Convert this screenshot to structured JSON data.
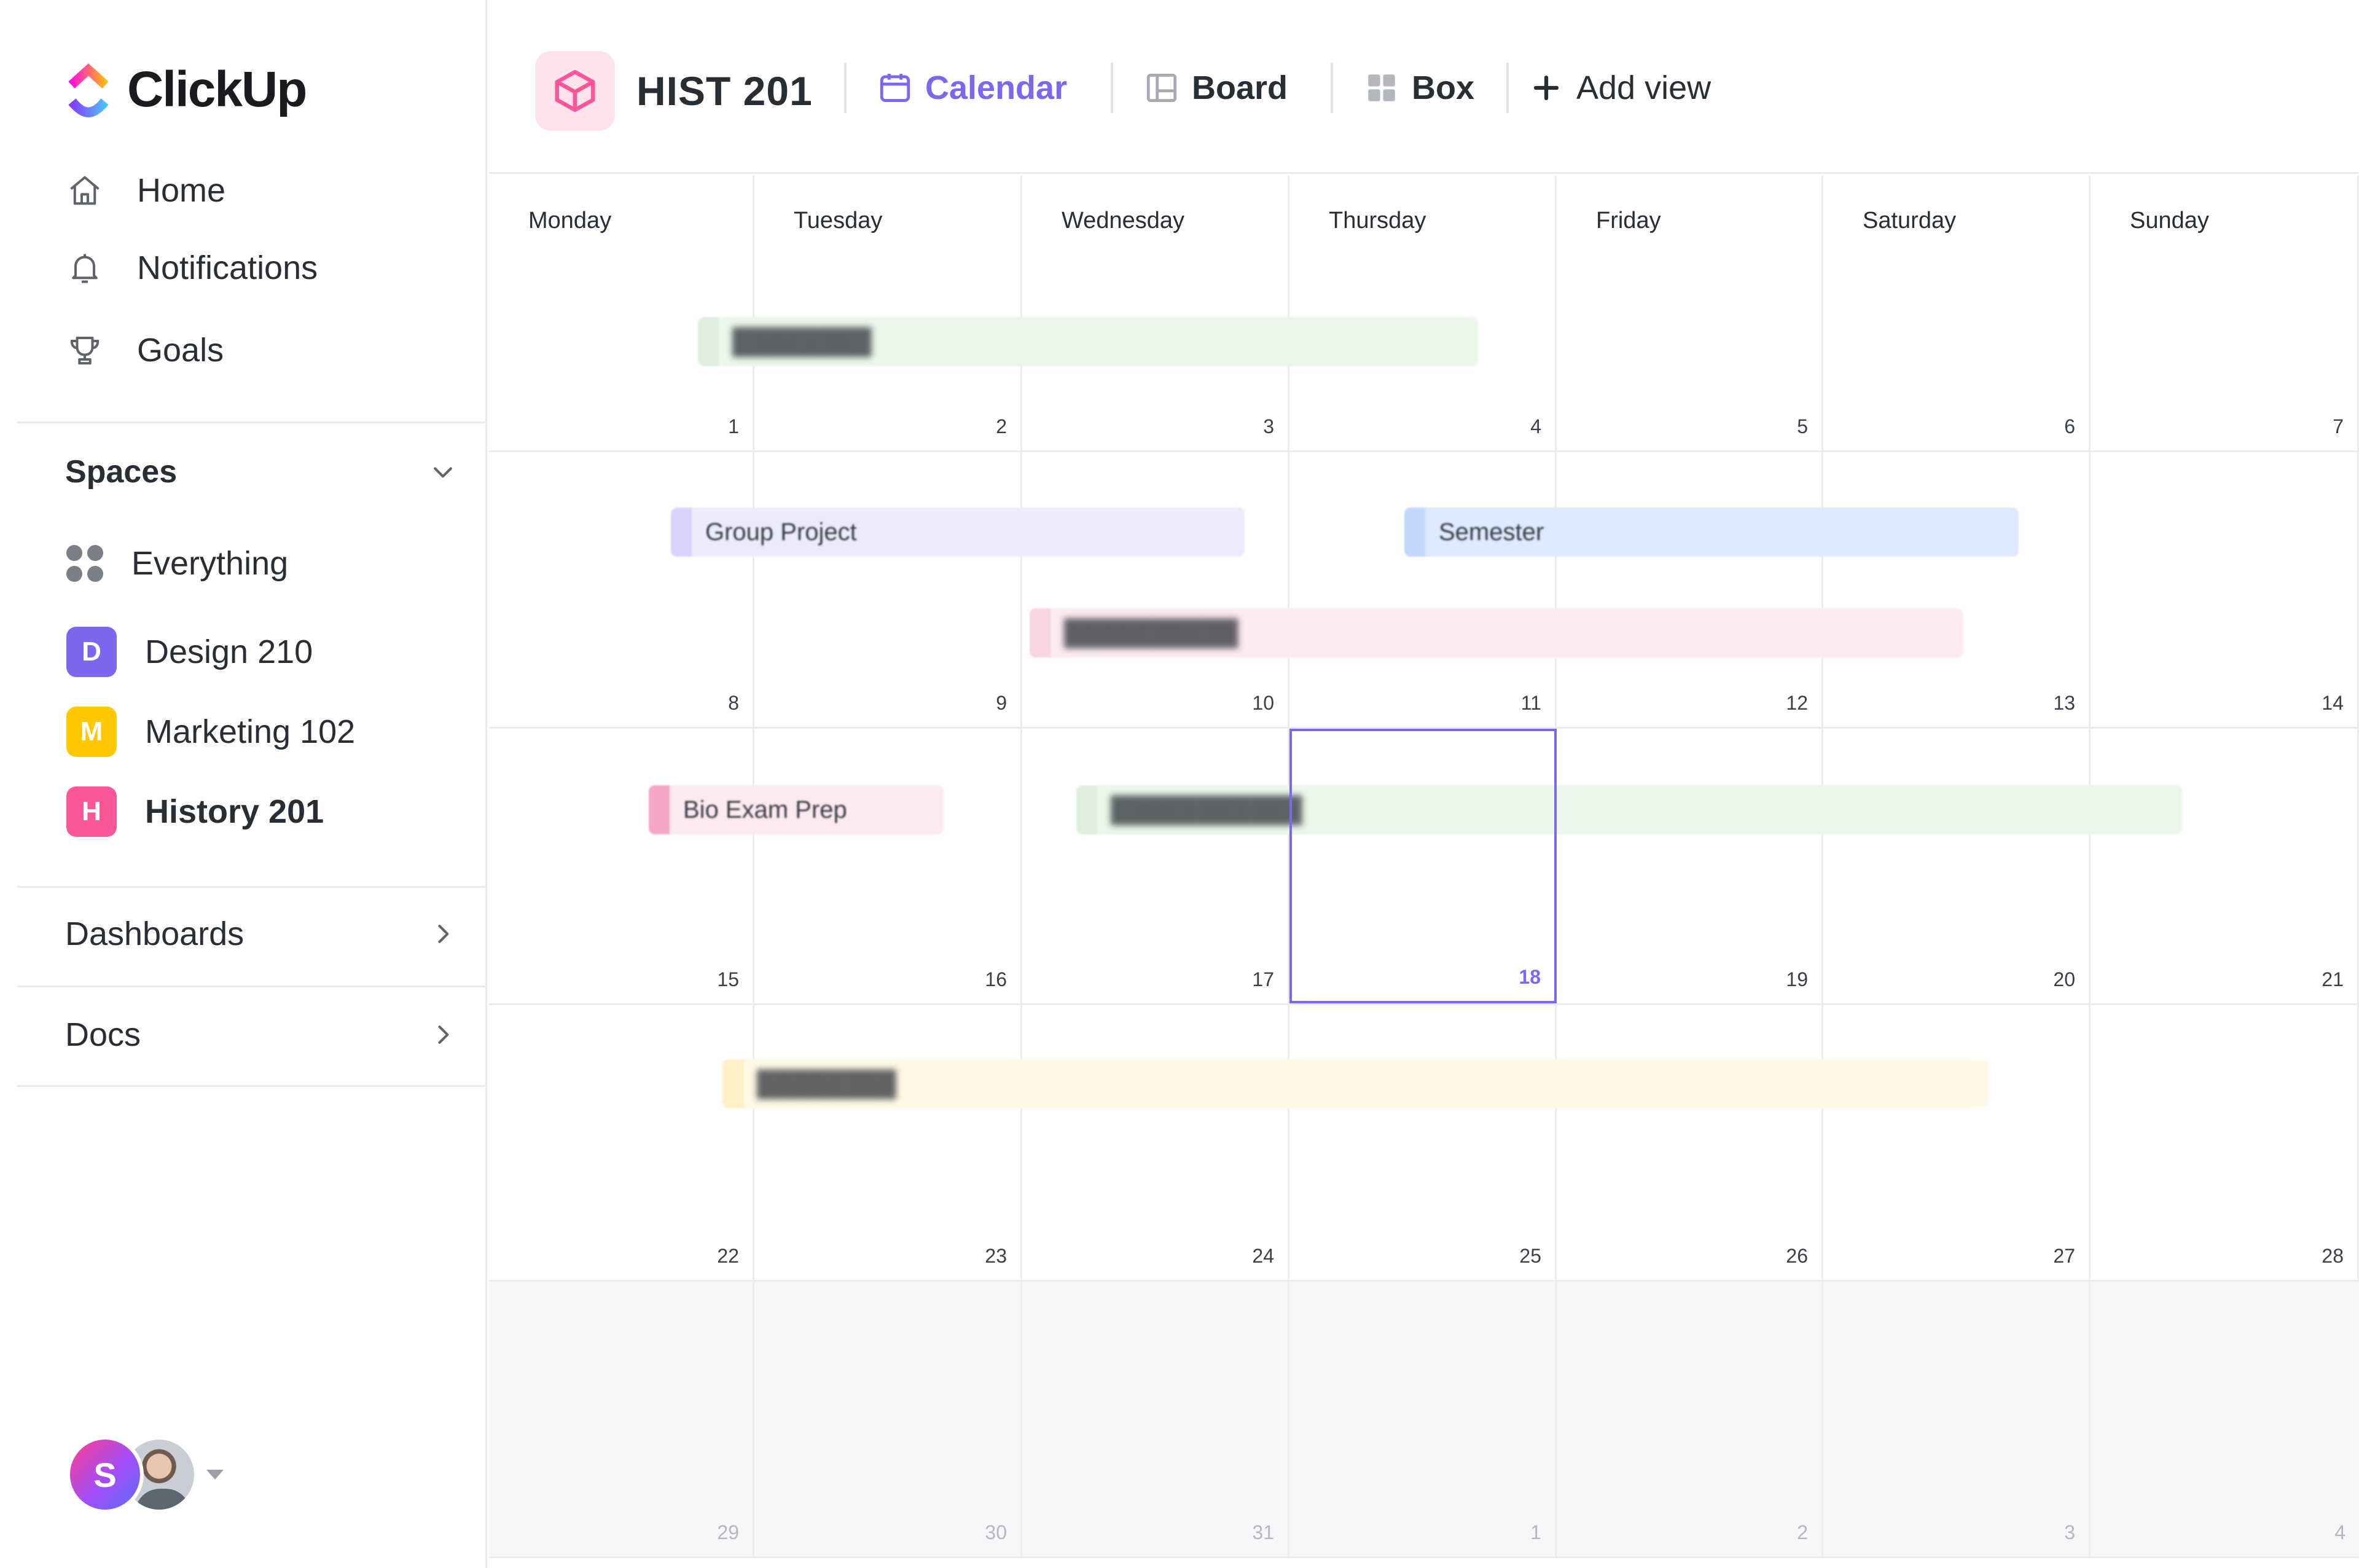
{
  "app": {
    "name": "ClickUp"
  },
  "sidebar": {
    "nav": [
      {
        "label": "Home",
        "icon": "home-icon"
      },
      {
        "label": "Notifications",
        "icon": "bell-icon"
      },
      {
        "label": "Goals",
        "icon": "trophy-icon"
      }
    ],
    "spaces_label": "Spaces",
    "spaces": [
      {
        "label": "Everything",
        "icon": "grid-dots-icon"
      },
      {
        "label": "Design 210",
        "badge": "D",
        "color": "#7b68ee"
      },
      {
        "label": "Marketing 102",
        "badge": "M",
        "color": "#ffc800"
      },
      {
        "label": "History 201",
        "badge": "H",
        "color": "#f9579a",
        "active": true
      }
    ],
    "dashboards_label": "Dashboards",
    "docs_label": "Docs",
    "user_initial": "S"
  },
  "header": {
    "project_title": "HIST 201",
    "tabs": [
      {
        "label": "Calendar",
        "icon": "calendar-icon",
        "active": true
      },
      {
        "label": "Board",
        "icon": "board-icon"
      },
      {
        "label": "Box",
        "icon": "box-icon"
      },
      {
        "label": "Add view",
        "icon": "plus-icon"
      }
    ]
  },
  "calendar": {
    "days_of_week": [
      "Monday",
      "Tuesday",
      "Wednesday",
      "Thursday",
      "Friday",
      "Saturday",
      "Sunday"
    ],
    "weeks": [
      [
        "1",
        "2",
        "3",
        "4",
        "5",
        "6",
        "7"
      ],
      [
        "8",
        "9",
        "10",
        "11",
        "12",
        "13",
        "14"
      ],
      [
        "15",
        "16",
        "17",
        "18",
        "19",
        "20",
        "21"
      ],
      [
        "22",
        "23",
        "24",
        "25",
        "26",
        "27",
        "28"
      ],
      [
        "29",
        "30",
        "31",
        "1",
        "2",
        "3",
        "4"
      ]
    ],
    "today": "18",
    "events": [
      {
        "label": "Group Project",
        "color": "#7b68ee"
      },
      {
        "label": "Semester",
        "color": "#4a90f2"
      },
      {
        "label": "Bio Exam Prep",
        "color": "#f9579a"
      }
    ]
  }
}
